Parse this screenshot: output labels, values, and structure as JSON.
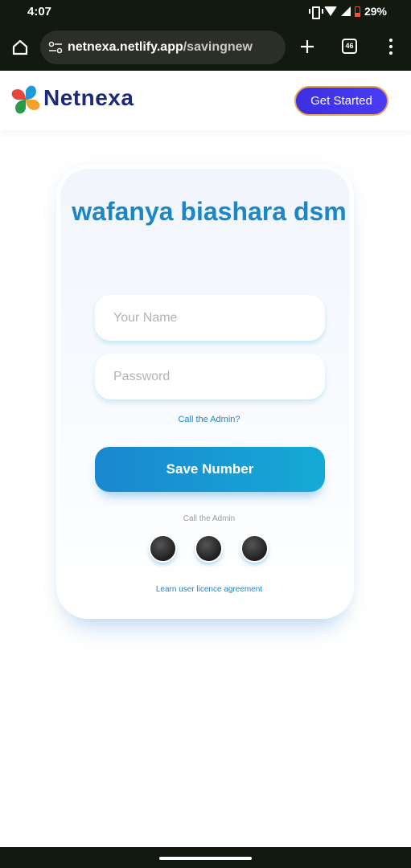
{
  "status_bar": {
    "time": "4:07",
    "battery": "29%",
    "icons": [
      "vibrate-icon",
      "wifi-icon",
      "signal-icon",
      "battery-icon"
    ]
  },
  "browser": {
    "url_host": "netnexa.netlify.app",
    "url_path": "/savingnew",
    "tab_count": "46",
    "icons": [
      "home-icon",
      "site-info-icon",
      "plus-icon",
      "tabs-icon",
      "more-vert-icon"
    ]
  },
  "header": {
    "logo": "Netnexa",
    "cta": "Get Started"
  },
  "card": {
    "title": "wafanya biashara dsm",
    "name_placeholder": "Your Name",
    "password_placeholder": "Password",
    "call_admin_link": "Call the Admin?",
    "save_button": "Save Number",
    "call_admin_text": "Call the Admin",
    "licence_link": "Learn user licence agreement"
  },
  "colors": {
    "title_blue": "#1b86c8",
    "button_gradient_start": "#1a87cf",
    "button_gradient_end": "#15aad6",
    "cta_purple": "#3b2fe0",
    "logo_navy": "#1d2a7a"
  }
}
